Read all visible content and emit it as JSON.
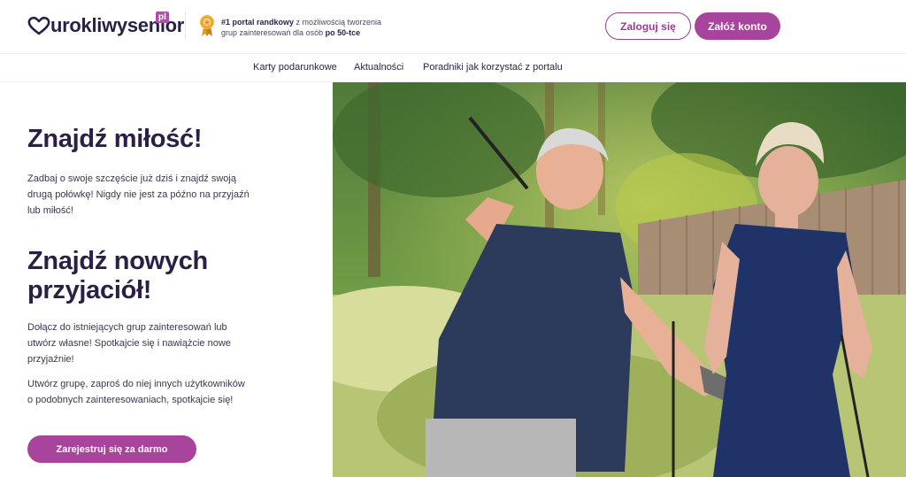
{
  "brand": {
    "name": "urokliwysenior",
    "tld": "pl"
  },
  "tagline": {
    "bold1": "#1 portal randkowy",
    "text1": " z możliwością tworzenia grup zainteresowań dla osób ",
    "bold2": "po 50-tce"
  },
  "header": {
    "login_label": "Zaloguj się",
    "register_label": "Załóż konto"
  },
  "nav": {
    "items": [
      {
        "label": "Karty podarunkowe"
      },
      {
        "label": "Aktualności"
      },
      {
        "label": "Poradniki jak korzystać z portalu"
      }
    ]
  },
  "main": {
    "heading1": "Znajdź miłość!",
    "paragraph1": "Zadbaj o swoje szczęście już dziś i znajdź swoją drugą połówkę! Nigdy nie jest za późno na przyjaźń lub miłość!",
    "heading2": "Znajdź nowych przyjaciół!",
    "paragraph2": "Dołącz do istniejących grup zainteresowań lub utwórz własne! Spotkajcie się i nawiążcie nowe przyjaźnie!",
    "paragraph3": "Utwórz grupę, zaproś do niej innych użytkowników o podobnych zainteresowaniach, spotkajcie się!",
    "cta_label": "Zarejestruj się za darmo"
  },
  "colors": {
    "brand": "#a9449c",
    "text": "#2b1f45"
  },
  "icons": {
    "logo": "heart-logo-icon",
    "medal": "medal-icon"
  }
}
